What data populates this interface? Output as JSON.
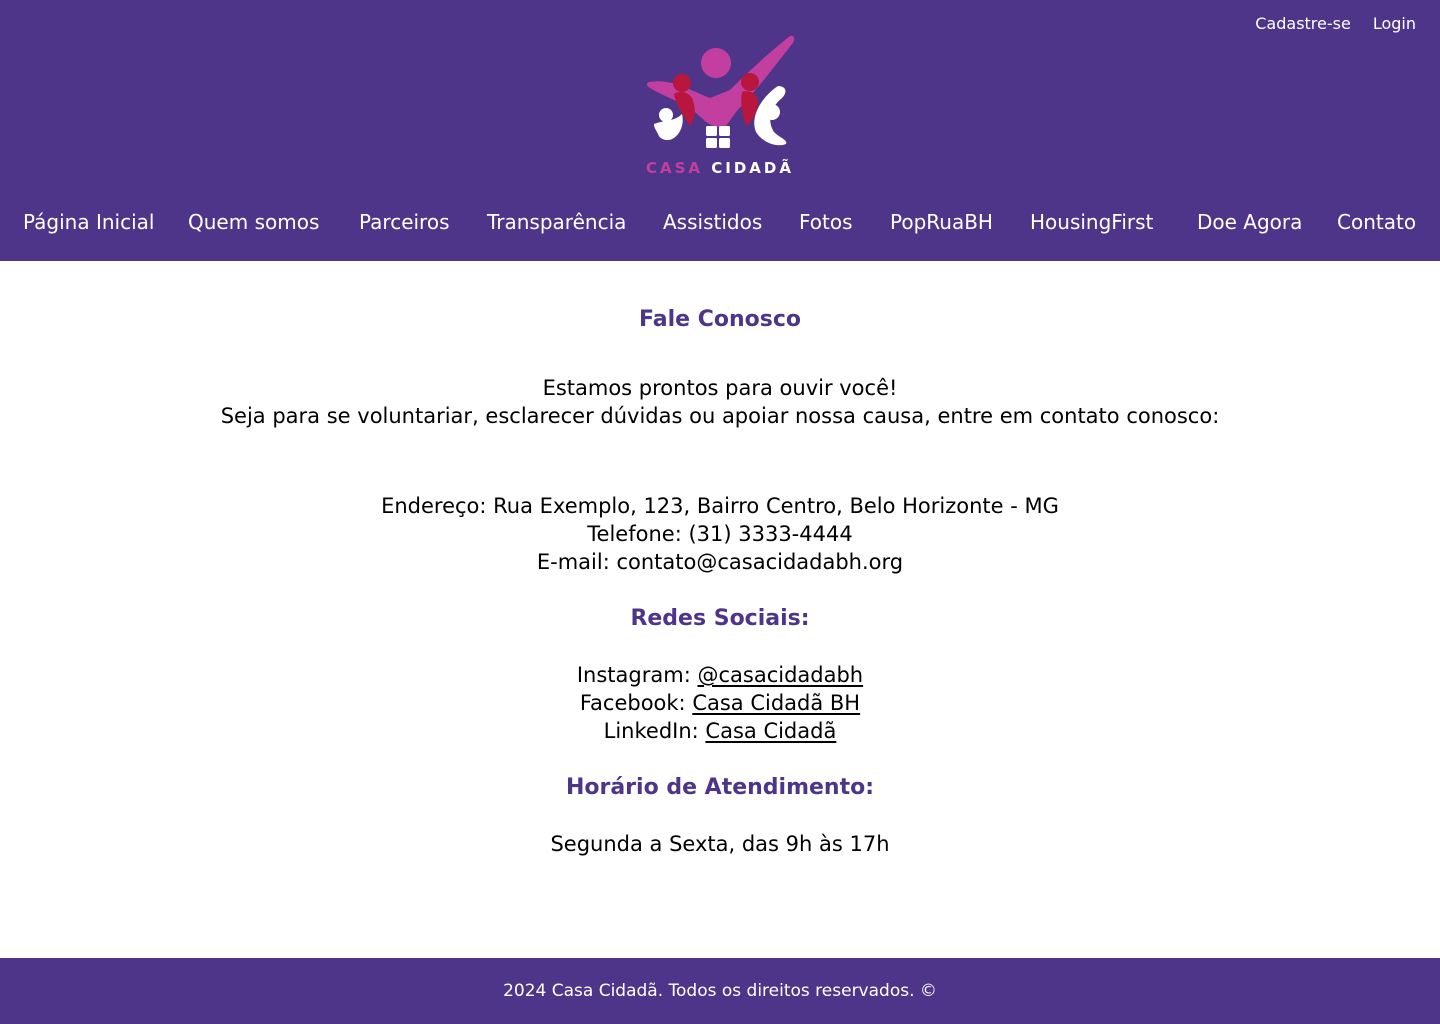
{
  "header": {
    "top_links": [
      "Cadastre-se",
      "Login"
    ],
    "logo": {
      "word1": "CASA",
      "word2": "CIDADÃ",
      "colors": {
        "magenta": "#c33f9f",
        "red": "#b8163c",
        "white": "#ffffff"
      }
    },
    "nav": [
      "Página Inicial",
      "Quem somos",
      "Parceiros",
      "Transparência",
      "Assistidos",
      "Fotos",
      "PopRuaBH",
      "HousingFirst",
      "Doe Agora",
      "Contato"
    ]
  },
  "main": {
    "title": "Fale Conosco",
    "intro_1": "Estamos prontos para ouvir você!",
    "intro_2": "Seja para se voluntariar, esclarecer dúvidas ou apoiar nossa causa, entre em contato conosco:",
    "address": "Endereço: Rua Exemplo, 123, Bairro Centro, Belo Horizonte - MG",
    "phone": "Telefone: (31) 3333-4444",
    "email": "E-mail: contato@casacidadabh.org",
    "social_title": "Redes Sociais:",
    "social": [
      {
        "label": "Instagram:",
        "link": "@casacidadabh"
      },
      {
        "label": "Facebook:",
        "link": "Casa Cidadã BH"
      },
      {
        "label": "LinkedIn:",
        "link": "Casa Cidadã"
      }
    ],
    "hours_title": "Horário de Atendimento:",
    "hours": "Segunda a Sexta, das 9h às 17h"
  },
  "footer": {
    "text": "2024 Casa Cidadã. Todos os direitos reservados. ©"
  },
  "colors": {
    "primary": "#4e3589",
    "text": "#000000",
    "background": "#ffffff"
  }
}
